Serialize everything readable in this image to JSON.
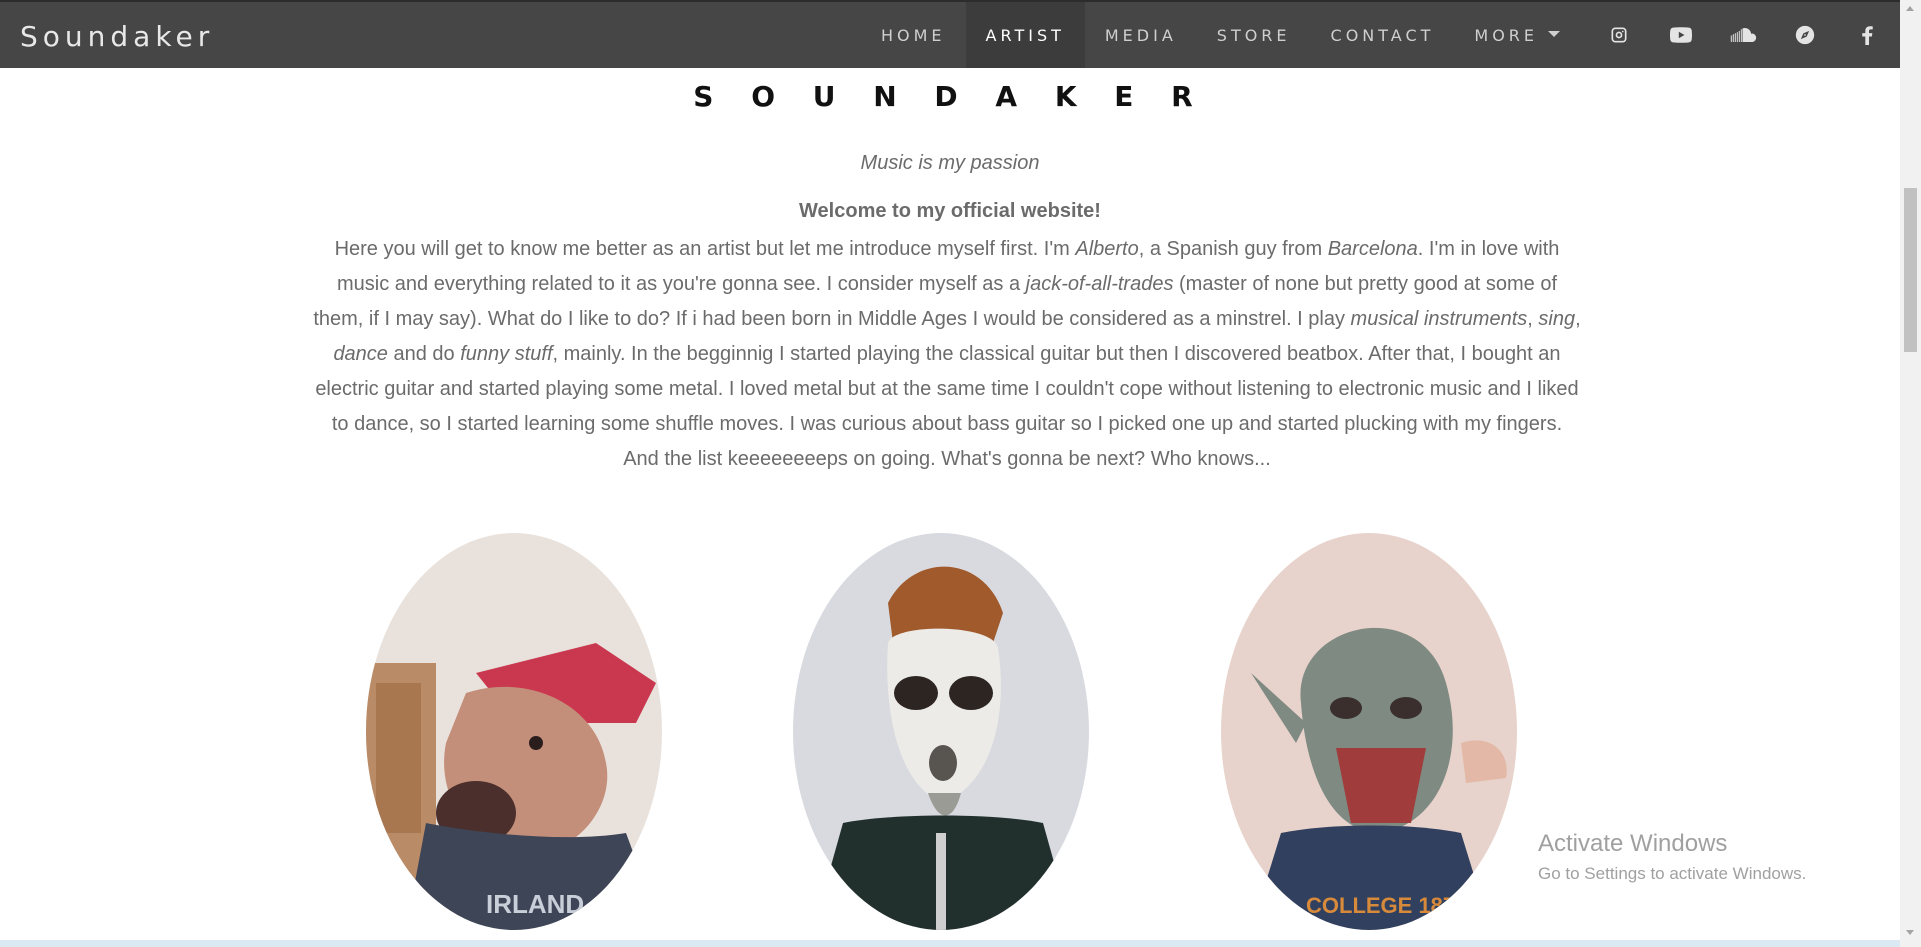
{
  "navbar": {
    "brand": "Soundaker",
    "items": [
      {
        "label": "HOME"
      },
      {
        "label": "ARTIST"
      },
      {
        "label": "MEDIA"
      },
      {
        "label": "STORE"
      },
      {
        "label": "CONTACT"
      },
      {
        "label": "MORE"
      }
    ],
    "active": "ARTIST",
    "social": [
      "instagram-icon",
      "youtube-icon",
      "soundcloud-icon",
      "compass-icon",
      "facebook-icon"
    ]
  },
  "main": {
    "title": "S O U N D A K E R",
    "tagline": "Music is my passion",
    "welcome": "Welcome to my official website!",
    "bio": {
      "t1": "Here you will get to know me better as an artist but let me introduce myself first. I'm ",
      "name": "Alberto",
      "t2": ", a Spanish guy from ",
      "city": "Barcelona",
      "t3": ". I'm in love with music and everything related to it as you're gonna see. I consider myself as a ",
      "jack": "jack-of-all-trades",
      "t4": " (master of none but pretty good at some of them, if I may say). What do I like to do? If i had been born in Middle Ages I would be considered as a minstrel. I play ",
      "instruments": "musical instruments",
      "t5": ", ",
      "sing": "sing",
      "t6": ", ",
      "dance": "dance",
      "t7": " and do ",
      "funny": "funny stuff",
      "t8": ", mainly. In the begginnig I started playing the classical guitar but then I discovered beatbox. After that, I bought an electric guitar and started playing some metal. I loved metal but at the same time I couldn't cope without listening to electronic music and I liked to dance, so I started learning some shuffle moves. I was curious about bass guitar so I picked one up and started plucking with my fingers. And the list keeeeeeeeps on going. What's gonna be next? Who knows..."
    }
  },
  "colors": {
    "navbar_bg": "#464646",
    "nav_active_bg": "#3c3c3c",
    "body_text": "#6b6b6b"
  },
  "watermark": {
    "title": "Activate Windows",
    "subtitle": "Go to Settings to activate Windows."
  }
}
